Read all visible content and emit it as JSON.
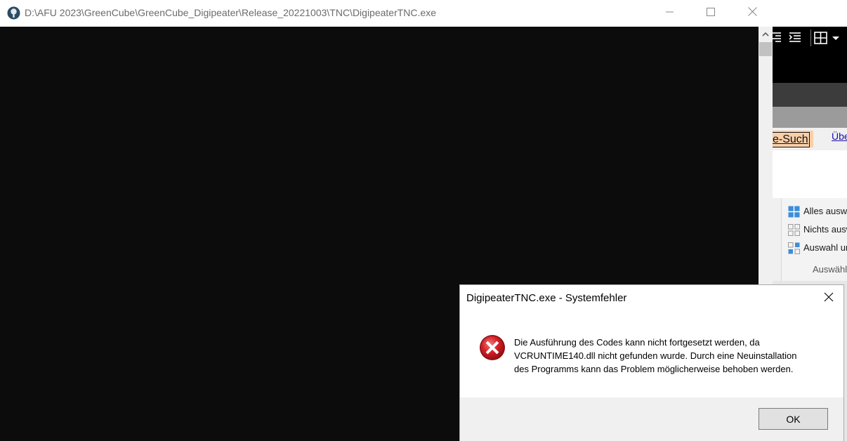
{
  "console": {
    "title": "D:\\AFU 2023\\GreenCube\\GreenCube_Digipeater\\Release_20221003\\TNC\\DigipeaterTNC.exe",
    "icon": "console-app-icon",
    "controls": {
      "minimize": "minimize-icon",
      "maximize": "maximize-icon",
      "close": "close-icon"
    }
  },
  "background_app": {
    "cell_text": "e-Such",
    "link_text": "Übe",
    "ribbon": {
      "items": [
        {
          "label": "Alles auswä",
          "icon": "select-all-icon"
        },
        {
          "label": "Nichts ausw",
          "icon": "select-none-icon"
        },
        {
          "label": "Auswahl ur",
          "icon": "invert-selection-icon"
        }
      ],
      "group_label": "Auswähle"
    }
  },
  "dialog": {
    "title": "DigipeaterTNC.exe - Systemfehler",
    "icon": "error-icon",
    "message_lines": [
      "Die Ausführung des Codes kann nicht fortgesetzt werden, da",
      "VCRUNTIME140.dll nicht gefunden wurde. Durch eine Neuinstallation",
      "des Programms kann das Problem möglicherweise behoben werden."
    ],
    "ok_label": "OK"
  },
  "colors": {
    "console_background": "#0c0c0c",
    "error_red": "#d41f26",
    "dialog_footer": "#f0f0f0",
    "highlight_cell": "#f9cfa8"
  }
}
